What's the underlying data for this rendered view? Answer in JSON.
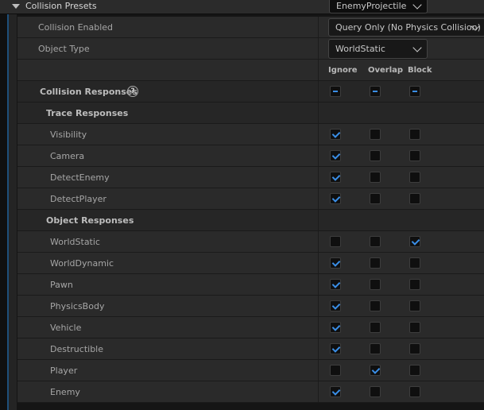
{
  "header": {
    "title": "Collision Presets",
    "preset_value": "EnemyProjectile"
  },
  "collision_enabled": {
    "label": "Collision Enabled",
    "value": "Query Only (No Physics Collision)"
  },
  "object_type": {
    "label": "Object Type",
    "value": "WorldStatic"
  },
  "columns": {
    "ignore": "Ignore",
    "overlap": "Overlap",
    "block": "Block"
  },
  "collision_responses": {
    "label": "Collision Responses",
    "help_glyph": "?"
  },
  "trace_responses": {
    "label": "Trace Responses",
    "rows": [
      {
        "label": "Visibility",
        "state": "ignore"
      },
      {
        "label": "Camera",
        "state": "ignore"
      },
      {
        "label": "DetectEnemy",
        "state": "ignore"
      },
      {
        "label": "DetectPlayer",
        "state": "ignore"
      }
    ]
  },
  "object_responses": {
    "label": "Object Responses",
    "rows": [
      {
        "label": "WorldStatic",
        "state": "block"
      },
      {
        "label": "WorldDynamic",
        "state": "ignore"
      },
      {
        "label": "Pawn",
        "state": "ignore"
      },
      {
        "label": "PhysicsBody",
        "state": "ignore"
      },
      {
        "label": "Vehicle",
        "state": "ignore"
      },
      {
        "label": "Destructible",
        "state": "ignore"
      },
      {
        "label": "Player",
        "state": "overlap"
      },
      {
        "label": "Enemy",
        "state": "ignore"
      }
    ]
  },
  "colors": {
    "accent": "#3a8ee6",
    "panel": "#262626",
    "row": "#2a2a2a"
  }
}
